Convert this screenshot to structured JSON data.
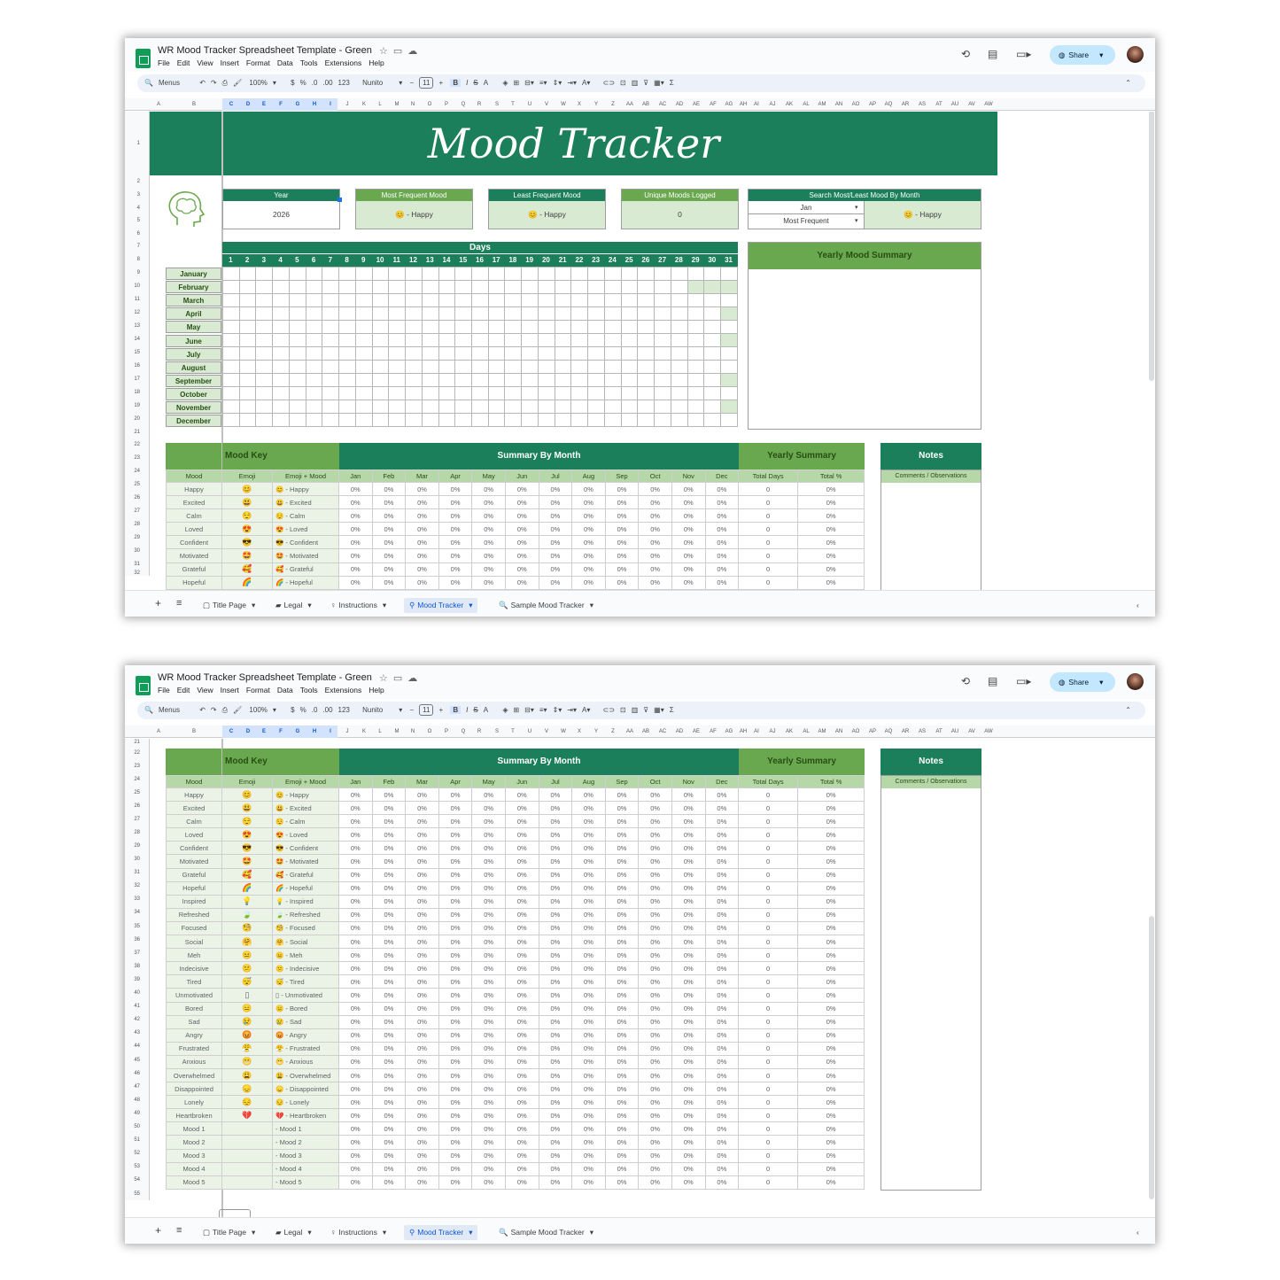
{
  "app": {
    "title": "WR Mood Tracker Spreadsheet Template - Green",
    "menus": [
      "File",
      "Edit",
      "View",
      "Insert",
      "Format",
      "Data",
      "Tools",
      "Extensions",
      "Help"
    ],
    "share": "Share"
  },
  "toolbar": {
    "search": "Menus",
    "zoom": "100%",
    "currency": "$",
    "percent": "%",
    "dec_less": ".0",
    "dec_more": ".00",
    "num": "123",
    "font": "Nunito",
    "size": "11"
  },
  "columns": [
    "A",
    "B",
    "C",
    "D",
    "E",
    "F",
    "G",
    "H",
    "I",
    "J",
    "K",
    "L",
    "M",
    "N",
    "O",
    "P",
    "Q",
    "R",
    "S",
    "T",
    "U",
    "V",
    "W",
    "X",
    "Y",
    "Z",
    "AA",
    "AB",
    "AC",
    "AD",
    "AE",
    "AF",
    "AG",
    "AH",
    "AI",
    "AJ",
    "AK",
    "AL",
    "AM",
    "AN",
    "AO",
    "AP",
    "AQ",
    "AR",
    "AS",
    "AT",
    "AU",
    "AV",
    "AW"
  ],
  "tabs": [
    "Title Page",
    "Legal",
    "Instructions",
    "Mood Tracker",
    "Sample Mood Tracker"
  ],
  "tracker": {
    "title": "Mood Tracker",
    "year_label": "Year",
    "year": "2026",
    "most_label": "Most Frequent Mood",
    "most_value": "😊 - Happy",
    "least_label": "Least Frequent Mood",
    "least_value": "😊 - Happy",
    "unique_label": "Unique Moods Logged",
    "unique_value": "0",
    "search_label": "Search Most/Least Mood By Month",
    "search_month": "Jan",
    "search_type": "Most Frequent",
    "search_value": "😊 - Happy",
    "days_label": "Days",
    "days": [
      "1",
      "2",
      "3",
      "4",
      "5",
      "6",
      "7",
      "8",
      "9",
      "10",
      "11",
      "12",
      "13",
      "14",
      "15",
      "16",
      "17",
      "18",
      "19",
      "20",
      "21",
      "22",
      "23",
      "24",
      "25",
      "26",
      "27",
      "28",
      "29",
      "30",
      "31"
    ],
    "months": [
      "January",
      "February",
      "March",
      "April",
      "May",
      "June",
      "July",
      "August",
      "September",
      "October",
      "November",
      "December"
    ],
    "yearly_mood_summary": "Yearly Mood Summary"
  },
  "summary": {
    "mood_key": "Mood Key",
    "by_month": "Summary By Month",
    "yearly": "Yearly Summary",
    "notes": "Notes",
    "notes_sub": "Comments / Observations",
    "headers": [
      "Mood",
      "Emoji",
      "Emoji + Mood",
      "Jan",
      "Feb",
      "Mar",
      "Apr",
      "May",
      "Jun",
      "Jul",
      "Aug",
      "Sep",
      "Oct",
      "Nov",
      "Dec",
      "Total Days",
      "Total %"
    ],
    "pct": "0%",
    "days": "0",
    "moods": [
      {
        "m": "Happy",
        "e": "😊"
      },
      {
        "m": "Excited",
        "e": "😃"
      },
      {
        "m": "Calm",
        "e": "😌"
      },
      {
        "m": "Loved",
        "e": "😍"
      },
      {
        "m": "Confident",
        "e": "😎"
      },
      {
        "m": "Motivated",
        "e": "🤩"
      },
      {
        "m": "Grateful",
        "e": "🥰"
      },
      {
        "m": "Hopeful",
        "e": "🌈"
      },
      {
        "m": "Inspired",
        "e": "💡"
      },
      {
        "m": "Refreshed",
        "e": "🍃"
      },
      {
        "m": "Focused",
        "e": "🧐"
      },
      {
        "m": "Social",
        "e": "🤗"
      },
      {
        "m": "Meh",
        "e": "😐"
      },
      {
        "m": "Indecisive",
        "e": "😕"
      },
      {
        "m": "Tired",
        "e": "😴"
      },
      {
        "m": "Unmotivated",
        "e": "▯"
      },
      {
        "m": "Bored",
        "e": "😑"
      },
      {
        "m": "Sad",
        "e": "😢"
      },
      {
        "m": "Angry",
        "e": "😡"
      },
      {
        "m": "Frustrated",
        "e": "😤"
      },
      {
        "m": "Anxious",
        "e": "😬"
      },
      {
        "m": "Overwhelmed",
        "e": "😩"
      },
      {
        "m": "Disappointed",
        "e": "😞"
      },
      {
        "m": "Lonely",
        "e": "😔"
      },
      {
        "m": "Heartbroken",
        "e": "💔"
      },
      {
        "m": "Mood 1",
        "e": ""
      },
      {
        "m": "Mood 2",
        "e": ""
      },
      {
        "m": "Mood 3",
        "e": ""
      },
      {
        "m": "Mood 4",
        "e": ""
      },
      {
        "m": "Mood 5",
        "e": ""
      }
    ]
  },
  "colors": {
    "dark_green": "#1b7f5b",
    "mid_green": "#6aa84f",
    "light_green": "#d9ead3"
  }
}
